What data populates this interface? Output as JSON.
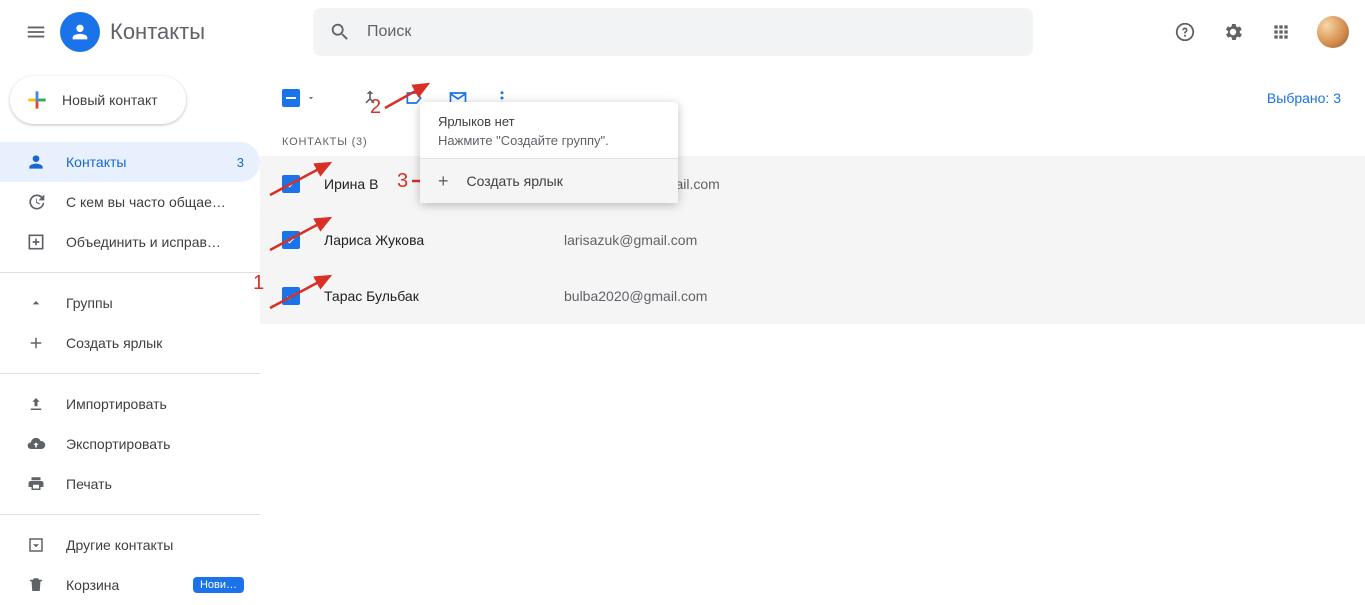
{
  "header": {
    "app_title": "Контакты",
    "search_placeholder": "Поиск"
  },
  "sidebar": {
    "create_label": "Новый контакт",
    "items": [
      {
        "icon": "person",
        "label": "Контакты",
        "count": "3",
        "active": true
      },
      {
        "icon": "history",
        "label": "С кем вы часто общае…"
      },
      {
        "icon": "merge-box",
        "label": "Объединить и исправ…"
      }
    ],
    "groups_label": "Группы",
    "create_label2": "Создать ярлык",
    "import_label": "Импортировать",
    "export_label": "Экспортировать",
    "print_label": "Печать",
    "other_label": "Другие контакты",
    "trash_label": "Корзина",
    "trash_badge": "Нови…"
  },
  "toolbar": {
    "selected_label": "Выбрано: 3"
  },
  "section_header": "КОНТАКТЫ (3)",
  "contacts": [
    {
      "name": "Ирина В",
      "email": "4@gmail.com"
    },
    {
      "name": "Лариса Жукова",
      "email": "larisazuk@gmail.com"
    },
    {
      "name": "Тарас Бульбак",
      "email": "bulba2020@gmail.com"
    }
  ],
  "popup": {
    "title": "Ярлыков нет",
    "subtitle": "Нажмите \"Создайте группу\".",
    "create_label": "Создать ярлык"
  },
  "annotations": {
    "n1": "1",
    "n2": "2",
    "n3": "3"
  }
}
